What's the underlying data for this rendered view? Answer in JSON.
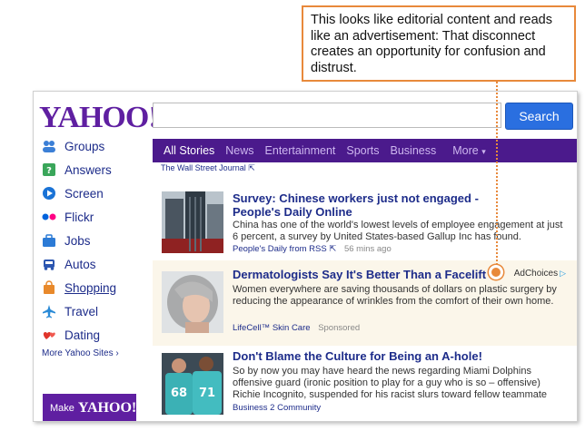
{
  "annotation": {
    "text": "This looks like editorial content and reads like an advertisement: That disconnect creates an opportunity for confusion and distrust."
  },
  "header": {
    "logo": "YAHOO!",
    "search_placeholder": "",
    "search_button": "Search"
  },
  "sidebar": {
    "items": [
      {
        "label": "Groups",
        "icon": "groups-icon"
      },
      {
        "label": "Answers",
        "icon": "answers-icon"
      },
      {
        "label": "Screen",
        "icon": "screen-icon"
      },
      {
        "label": "Flickr",
        "icon": "flickr-icon"
      },
      {
        "label": "Jobs",
        "icon": "jobs-icon"
      },
      {
        "label": "Autos",
        "icon": "autos-icon"
      },
      {
        "label": "Shopping",
        "icon": "shopping-icon"
      },
      {
        "label": "Travel",
        "icon": "travel-icon"
      },
      {
        "label": "Dating",
        "icon": "dating-icon"
      }
    ],
    "more_sites": "More Yahoo Sites ›",
    "make_prefix": "Make",
    "make_brand": "YAHOO!"
  },
  "nav": {
    "tabs": [
      "All Stories",
      "News",
      "Entertainment",
      "Sports",
      "Business"
    ],
    "more": "More"
  },
  "wsj_credit": "The Wall Street Journal",
  "stories": [
    {
      "headline_line1": "Survey: Chinese workers just not engaged -",
      "headline_line2": "People's Daily Online",
      "summary": "China has one of the world's lowest levels of employee engagement at just 6 percent, a survey by United States-based Gallup Inc has found.",
      "source": "People's Daily from RSS",
      "time": "56 mins ago"
    },
    {
      "headline": "Dermatologists Say It's Better Than a Facelift",
      "summary": "Women everywhere are saving thousands of dollars on plastic surgery by reducing the appearance of wrinkles from the comfort of their own home.",
      "source": "LifeCell™ Skin Care",
      "sponsored": "Sponsored",
      "adchoices": "AdChoices"
    },
    {
      "headline": "Don't Blame the Culture for Being an A-hole!",
      "summary": "So by now you may have heard the news regarding Miami Dolphins offensive guard (ironic position to play for a guy who is so – offensive) Richie Incognito, suspended for his racist slurs toward fellow teammate",
      "source": "Business 2 Community",
      "jersey_a": "68",
      "jersey_b": "71"
    }
  ],
  "colors": {
    "brand_purple": "#5f1fa1",
    "nav_purple": "#4b1a8c",
    "link_blue": "#1d2c8a",
    "search_blue": "#2a6fe0",
    "callout_orange": "#e8893b",
    "ad_background": "#fbf6ea"
  }
}
